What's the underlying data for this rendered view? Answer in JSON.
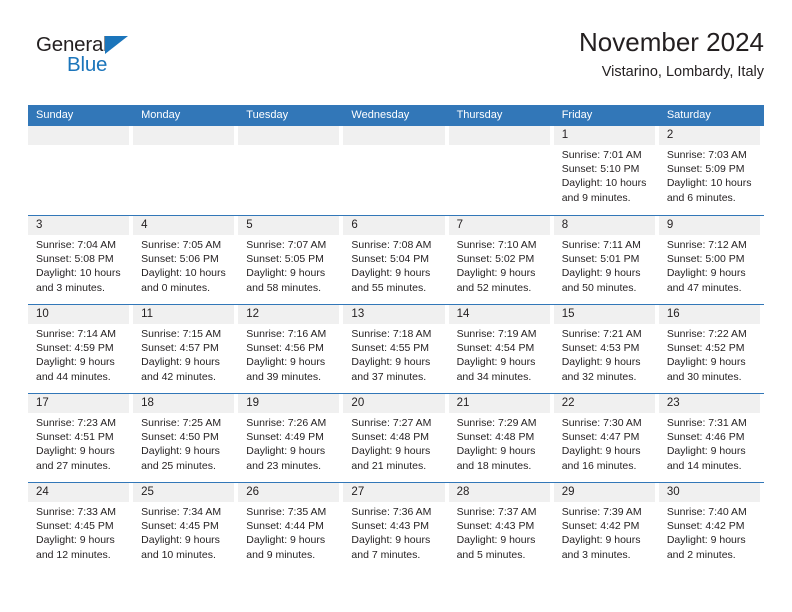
{
  "brand": {
    "name_top": "General",
    "name_bottom": "Blue",
    "accent_color": "#1b75bb"
  },
  "header": {
    "title": "November 2024",
    "subtitle": "Vistarino, Lombardy, Italy"
  },
  "calendar": {
    "header_bg": "#3277b8",
    "daynum_bg": "#f0f0f0",
    "weekdays": [
      "Sunday",
      "Monday",
      "Tuesday",
      "Wednesday",
      "Thursday",
      "Friday",
      "Saturday"
    ],
    "weeks": [
      [
        {
          "day": "",
          "lines": []
        },
        {
          "day": "",
          "lines": []
        },
        {
          "day": "",
          "lines": []
        },
        {
          "day": "",
          "lines": []
        },
        {
          "day": "",
          "lines": []
        },
        {
          "day": "1",
          "lines": [
            "Sunrise: 7:01 AM",
            "Sunset: 5:10 PM",
            "Daylight: 10 hours",
            "and 9 minutes."
          ]
        },
        {
          "day": "2",
          "lines": [
            "Sunrise: 7:03 AM",
            "Sunset: 5:09 PM",
            "Daylight: 10 hours",
            "and 6 minutes."
          ]
        }
      ],
      [
        {
          "day": "3",
          "lines": [
            "Sunrise: 7:04 AM",
            "Sunset: 5:08 PM",
            "Daylight: 10 hours",
            "and 3 minutes."
          ]
        },
        {
          "day": "4",
          "lines": [
            "Sunrise: 7:05 AM",
            "Sunset: 5:06 PM",
            "Daylight: 10 hours",
            "and 0 minutes."
          ]
        },
        {
          "day": "5",
          "lines": [
            "Sunrise: 7:07 AM",
            "Sunset: 5:05 PM",
            "Daylight: 9 hours",
            "and 58 minutes."
          ]
        },
        {
          "day": "6",
          "lines": [
            "Sunrise: 7:08 AM",
            "Sunset: 5:04 PM",
            "Daylight: 9 hours",
            "and 55 minutes."
          ]
        },
        {
          "day": "7",
          "lines": [
            "Sunrise: 7:10 AM",
            "Sunset: 5:02 PM",
            "Daylight: 9 hours",
            "and 52 minutes."
          ]
        },
        {
          "day": "8",
          "lines": [
            "Sunrise: 7:11 AM",
            "Sunset: 5:01 PM",
            "Daylight: 9 hours",
            "and 50 minutes."
          ]
        },
        {
          "day": "9",
          "lines": [
            "Sunrise: 7:12 AM",
            "Sunset: 5:00 PM",
            "Daylight: 9 hours",
            "and 47 minutes."
          ]
        }
      ],
      [
        {
          "day": "10",
          "lines": [
            "Sunrise: 7:14 AM",
            "Sunset: 4:59 PM",
            "Daylight: 9 hours",
            "and 44 minutes."
          ]
        },
        {
          "day": "11",
          "lines": [
            "Sunrise: 7:15 AM",
            "Sunset: 4:57 PM",
            "Daylight: 9 hours",
            "and 42 minutes."
          ]
        },
        {
          "day": "12",
          "lines": [
            "Sunrise: 7:16 AM",
            "Sunset: 4:56 PM",
            "Daylight: 9 hours",
            "and 39 minutes."
          ]
        },
        {
          "day": "13",
          "lines": [
            "Sunrise: 7:18 AM",
            "Sunset: 4:55 PM",
            "Daylight: 9 hours",
            "and 37 minutes."
          ]
        },
        {
          "day": "14",
          "lines": [
            "Sunrise: 7:19 AM",
            "Sunset: 4:54 PM",
            "Daylight: 9 hours",
            "and 34 minutes."
          ]
        },
        {
          "day": "15",
          "lines": [
            "Sunrise: 7:21 AM",
            "Sunset: 4:53 PM",
            "Daylight: 9 hours",
            "and 32 minutes."
          ]
        },
        {
          "day": "16",
          "lines": [
            "Sunrise: 7:22 AM",
            "Sunset: 4:52 PM",
            "Daylight: 9 hours",
            "and 30 minutes."
          ]
        }
      ],
      [
        {
          "day": "17",
          "lines": [
            "Sunrise: 7:23 AM",
            "Sunset: 4:51 PM",
            "Daylight: 9 hours",
            "and 27 minutes."
          ]
        },
        {
          "day": "18",
          "lines": [
            "Sunrise: 7:25 AM",
            "Sunset: 4:50 PM",
            "Daylight: 9 hours",
            "and 25 minutes."
          ]
        },
        {
          "day": "19",
          "lines": [
            "Sunrise: 7:26 AM",
            "Sunset: 4:49 PM",
            "Daylight: 9 hours",
            "and 23 minutes."
          ]
        },
        {
          "day": "20",
          "lines": [
            "Sunrise: 7:27 AM",
            "Sunset: 4:48 PM",
            "Daylight: 9 hours",
            "and 21 minutes."
          ]
        },
        {
          "day": "21",
          "lines": [
            "Sunrise: 7:29 AM",
            "Sunset: 4:48 PM",
            "Daylight: 9 hours",
            "and 18 minutes."
          ]
        },
        {
          "day": "22",
          "lines": [
            "Sunrise: 7:30 AM",
            "Sunset: 4:47 PM",
            "Daylight: 9 hours",
            "and 16 minutes."
          ]
        },
        {
          "day": "23",
          "lines": [
            "Sunrise: 7:31 AM",
            "Sunset: 4:46 PM",
            "Daylight: 9 hours",
            "and 14 minutes."
          ]
        }
      ],
      [
        {
          "day": "24",
          "lines": [
            "Sunrise: 7:33 AM",
            "Sunset: 4:45 PM",
            "Daylight: 9 hours",
            "and 12 minutes."
          ]
        },
        {
          "day": "25",
          "lines": [
            "Sunrise: 7:34 AM",
            "Sunset: 4:45 PM",
            "Daylight: 9 hours",
            "and 10 minutes."
          ]
        },
        {
          "day": "26",
          "lines": [
            "Sunrise: 7:35 AM",
            "Sunset: 4:44 PM",
            "Daylight: 9 hours",
            "and 9 minutes."
          ]
        },
        {
          "day": "27",
          "lines": [
            "Sunrise: 7:36 AM",
            "Sunset: 4:43 PM",
            "Daylight: 9 hours",
            "and 7 minutes."
          ]
        },
        {
          "day": "28",
          "lines": [
            "Sunrise: 7:37 AM",
            "Sunset: 4:43 PM",
            "Daylight: 9 hours",
            "and 5 minutes."
          ]
        },
        {
          "day": "29",
          "lines": [
            "Sunrise: 7:39 AM",
            "Sunset: 4:42 PM",
            "Daylight: 9 hours",
            "and 3 minutes."
          ]
        },
        {
          "day": "30",
          "lines": [
            "Sunrise: 7:40 AM",
            "Sunset: 4:42 PM",
            "Daylight: 9 hours",
            "and 2 minutes."
          ]
        }
      ]
    ]
  }
}
